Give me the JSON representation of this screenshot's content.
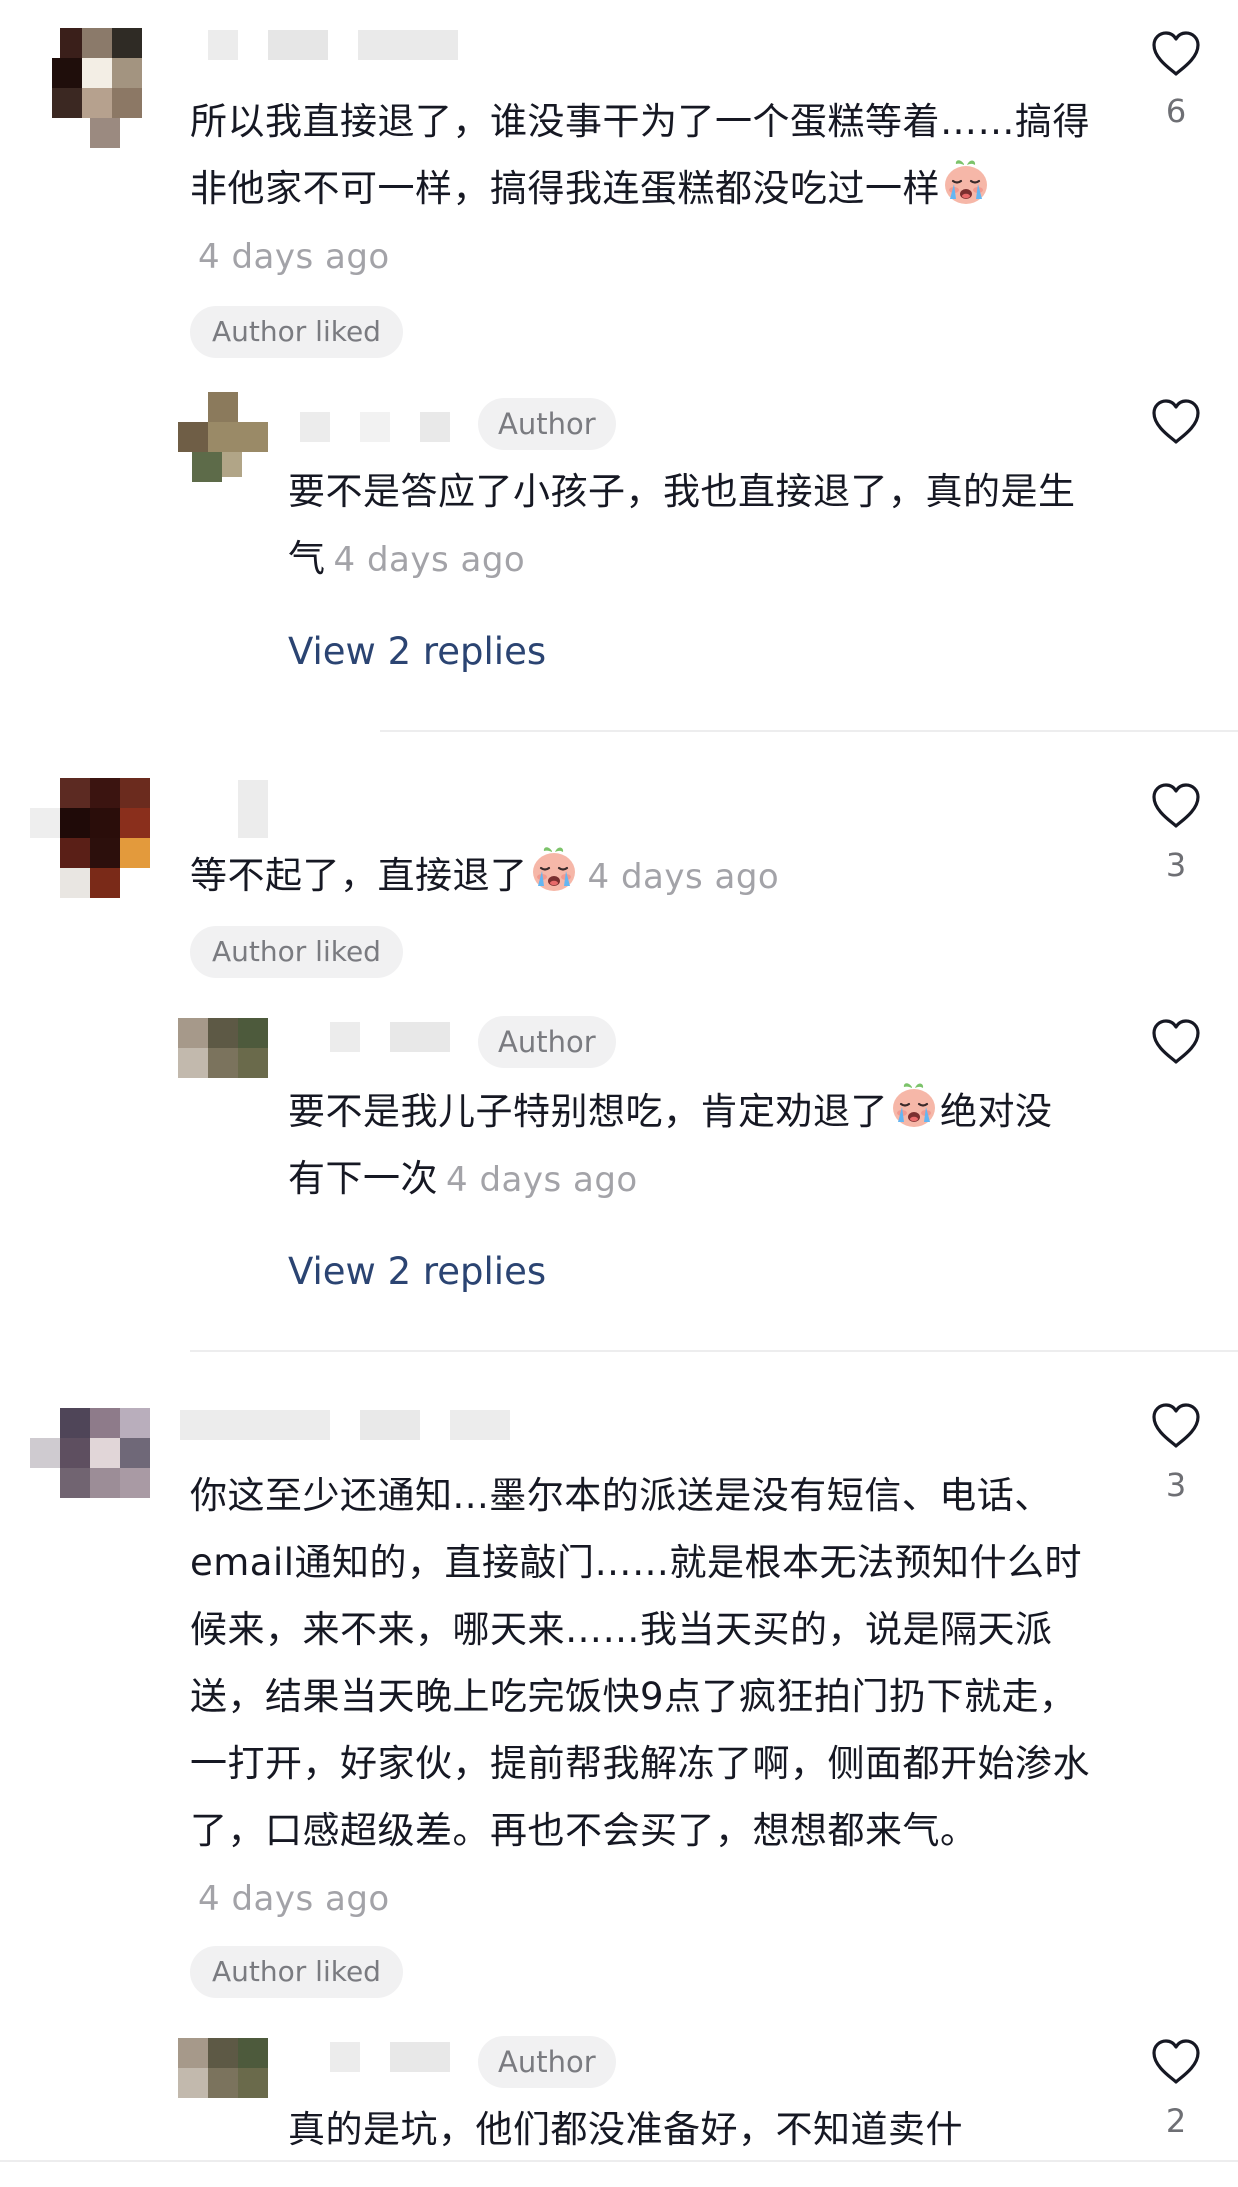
{
  "comments": [
    {
      "text": "所以我直接退了，谁没事干为了一个蛋糕等着……搞得非他家不可一样，搞得我连蛋糕都没吃过一样",
      "emoji": "crying-face-emoji",
      "time": "4 days ago",
      "author_liked_label": "Author liked",
      "like_count": "6",
      "reply": {
        "badge": "Author",
        "text": "要不是答应了小孩子，我也直接退了，真的是生气",
        "time": "4 days ago",
        "view_replies": "View 2 replies"
      }
    },
    {
      "text": "等不起了，直接退了",
      "emoji": "crying-face-emoji",
      "time": "4 days ago",
      "author_liked_label": "Author liked",
      "like_count": "3",
      "reply": {
        "badge": "Author",
        "text": "要不是我儿子特别想吃，肯定劝退了",
        "emoji": "crying-face-emoji",
        "text_after": "绝对没有下一次",
        "time": "4 days ago",
        "view_replies": "View 2 replies"
      }
    },
    {
      "text": "你这至少还通知...墨尔本的派送是没有短信、电话、email通知的，直接敲门……就是根本无法预知什么时候来，来不来，哪天来……我当天买的，说是隔天派送，结果当天晚上吃完饭快9点了疯狂拍门扔下就走，一打开，好家伙，提前帮我解冻了啊，侧面都开始渗水了，口感超级差。再也不会买了，想想都来气。",
      "time": "4 days ago",
      "author_liked_label": "Author liked",
      "like_count": "3",
      "reply": {
        "badge": "Author",
        "text": "真的是坑，他们都没准备好，不知道卖什",
        "like_count": "2"
      }
    }
  ],
  "colors": {
    "text": "#161823",
    "time": "#a3a3a8",
    "link": "#2b4472",
    "badge_bg": "#f1f1f2"
  },
  "icons": {
    "like": "heart-outline-icon",
    "emoji": "crying-face-emoji"
  }
}
